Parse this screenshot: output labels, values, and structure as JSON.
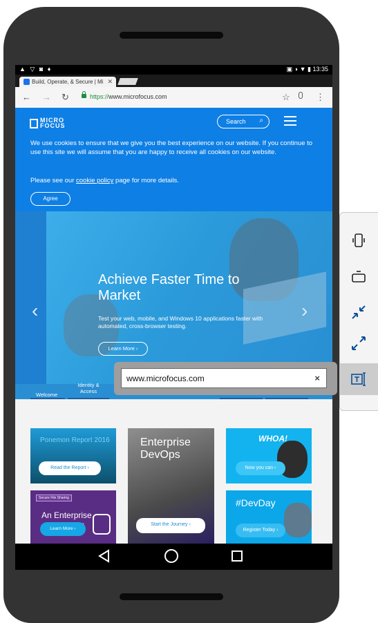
{
  "status_bar": {
    "left_icons": "▲ ▽ ◙ ♦",
    "right_icons": "▣ ◑ ▼ ▮",
    "time": "13:35"
  },
  "browser": {
    "tab_title": "Build, Operate, & Secure | Mi",
    "tab_close": "✕",
    "url_scheme": "https://",
    "url_host": "www.microfocus.com",
    "icons": [
      "back-icon",
      "forward-icon",
      "reload-icon",
      "lock-icon",
      "star-icon",
      "mic-icon",
      "more-icon"
    ]
  },
  "site": {
    "logo_line1": "MICRO",
    "logo_line2": "FOCUS",
    "search_label": "Search",
    "cookie_text": "We use cookies to ensure that we give you the best experience on our website. If you continue to use this site we will assume that you are happy to receive all cookies on our website.",
    "cookie_see_prefix": "Please see our ",
    "cookie_link": "cookie policy",
    "cookie_see_suffix": " page for more details.",
    "agree": "Agree",
    "hero_title": "Achieve Faster Time to Market",
    "hero_text": "Test your web, mobile, and Windows 10 applications faster with automated, cross-browser testing.",
    "learn_more": "Learn More ›",
    "hero_tabs": [
      "Welcome",
      "Identity & Access"
    ]
  },
  "tiles": {
    "t1_title": "Ponemon Report 2016",
    "t1_btn": "Read the Report ›",
    "t2_title": "Enterprise DevOps",
    "t2_btn": "Start the Journey ›",
    "t3_title": "WHOA!",
    "t3_btn": "Now you can ›",
    "t4_badge": "Secure File Sharing",
    "t4_title": "An Enterprise Access and",
    "t4_btn": "Learn More ›",
    "t5_title": "#DevDay",
    "t5_btn": "Register Today ›"
  },
  "url_input": {
    "value": "www.microfocus.com",
    "clear": "×"
  },
  "toolbar_icons": [
    "phone-portrait-icon",
    "phone-landscape-icon",
    "shrink-icon",
    "expand-icon",
    "text-input-icon"
  ],
  "colors": {
    "site_blue": "#0e7fe5",
    "phone_body": "#333333"
  }
}
